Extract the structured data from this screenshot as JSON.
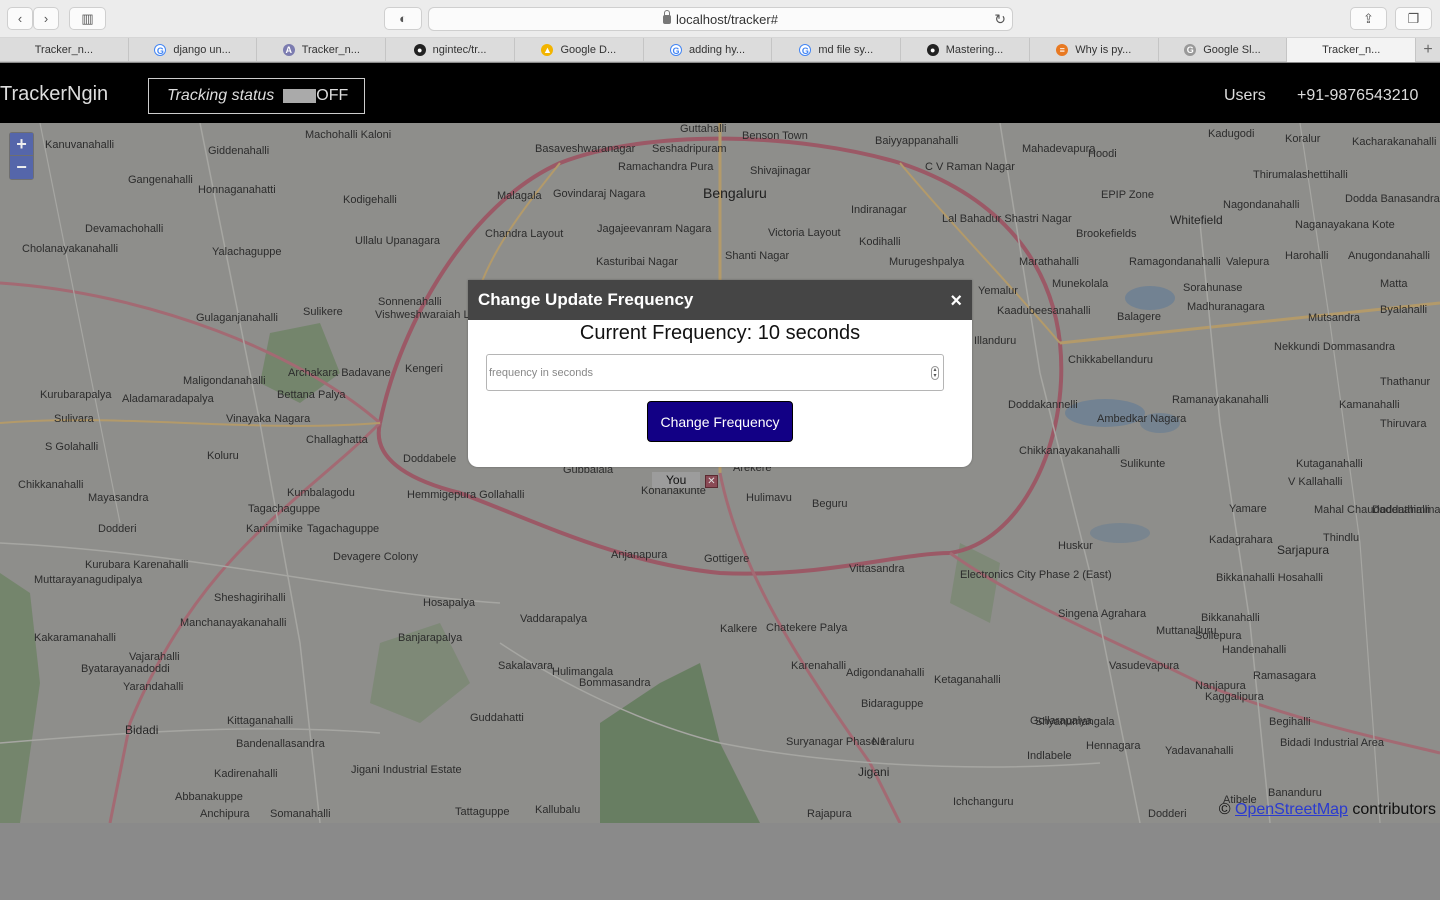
{
  "browser": {
    "url": "localhost/tracker#",
    "tabs": [
      {
        "label": "Tracker_n...",
        "icon": "none"
      },
      {
        "label": "django un...",
        "icon": "google-icon"
      },
      {
        "label": "Tracker_n...",
        "icon": "app-icon"
      },
      {
        "label": "ngintec/tr...",
        "icon": "github-icon"
      },
      {
        "label": "Google D...",
        "icon": "google-drive-icon"
      },
      {
        "label": "adding hy...",
        "icon": "google-icon"
      },
      {
        "label": "md file sy...",
        "icon": "google-icon"
      },
      {
        "label": "Mastering...",
        "icon": "github-icon"
      },
      {
        "label": "Why is py...",
        "icon": "stackoverflow-icon"
      },
      {
        "label": "Google Sl...",
        "icon": "google-slides-icon"
      },
      {
        "label": "Tracker_n...",
        "icon": "none",
        "active": true
      }
    ]
  },
  "header": {
    "brand": "TrackerNgin",
    "tracking_label": "Tracking status",
    "tracking_value": "OFF",
    "nav_users": "Users",
    "nav_phone": "+91-9876543210"
  },
  "map": {
    "you_label": "You",
    "attribution_prefix": "©",
    "attribution_link": "OpenStreetMap",
    "attribution_suffix": "contributors",
    "places": [
      {
        "t": "Bengaluru",
        "c": "big"
      },
      {
        "t": "Whitefield",
        "c": "mid"
      },
      {
        "t": "Bidadi",
        "c": "mid"
      },
      {
        "t": "Jigani",
        "c": "mid"
      },
      {
        "t": "Sarjapura",
        "c": "mid"
      },
      {
        "t": "Kanuvanahalli"
      },
      {
        "t": "Giddenahalli"
      },
      {
        "t": "Machohalli Kaloni"
      },
      {
        "t": "Basaveshwaranagar"
      },
      {
        "t": "Seshadripuram"
      },
      {
        "t": "Guttahalli"
      },
      {
        "t": "Benson Town"
      },
      {
        "t": "Baiyyappanahalli"
      },
      {
        "t": "Mahadevapura"
      },
      {
        "t": "Kadugodi"
      },
      {
        "t": "Koralur"
      },
      {
        "t": "Kacharakanahalli"
      },
      {
        "t": "Hoodi"
      },
      {
        "t": "C V Raman Nagar"
      },
      {
        "t": "Gangenahalli"
      },
      {
        "t": "Honnaganahatti"
      },
      {
        "t": "Kodigehalli"
      },
      {
        "t": "Malagala"
      },
      {
        "t": "Govindaraj Nagara"
      },
      {
        "t": "Ramachandra Pura"
      },
      {
        "t": "Shivajinagar"
      },
      {
        "t": "Thirumalashettihalli"
      },
      {
        "t": "EPIP Zone"
      },
      {
        "t": "Nagondanahalli"
      },
      {
        "t": "Dodda Banasandra"
      },
      {
        "t": "Devamachohalli"
      },
      {
        "t": "Ullalu Upanagara"
      },
      {
        "t": "Chandra Layout"
      },
      {
        "t": "Jagajeevanram Nagara"
      },
      {
        "t": "Victoria Layout"
      },
      {
        "t": "Indiranagar"
      },
      {
        "t": "Lal Bahadur Shastri Nagar"
      },
      {
        "t": "Brookefields"
      },
      {
        "t": "Naganayakana Kote"
      },
      {
        "t": "Cholanayakanahalli"
      },
      {
        "t": "Yalachaguppe"
      },
      {
        "t": "Kasturibai Nagar"
      },
      {
        "t": "Shanti Nagar"
      },
      {
        "t": "Kodihalli"
      },
      {
        "t": "Murugeshpalya"
      },
      {
        "t": "Marathahalli"
      },
      {
        "t": "Ramagondanahalli"
      },
      {
        "t": "Valepura"
      },
      {
        "t": "Harohalli"
      },
      {
        "t": "Anugondanahalli"
      },
      {
        "t": "Sonnenahalli"
      },
      {
        "t": "Vishweshwaraiah Layout"
      },
      {
        "t": "Yemalur"
      },
      {
        "t": "Munekolala"
      },
      {
        "t": "Sorahunase"
      },
      {
        "t": "Matta"
      },
      {
        "t": "Gulaganjanahalli"
      },
      {
        "t": "Sulikere"
      },
      {
        "t": "Kaadubeesanahalli"
      },
      {
        "t": "Balagere"
      },
      {
        "t": "Madhuranagara"
      },
      {
        "t": "Mutsandra"
      },
      {
        "t": "Byalahalli"
      },
      {
        "t": "Illanduru"
      },
      {
        "t": "Nekkundi Dommasandra"
      },
      {
        "t": "Maligondanahalli"
      },
      {
        "t": "Archakara Badavane"
      },
      {
        "t": "Kengeri"
      },
      {
        "t": "Chikkabellanduru"
      },
      {
        "t": "Thathanur"
      },
      {
        "t": "Kurubarapalya"
      },
      {
        "t": "Aladamaradapalya"
      },
      {
        "t": "Bettana Palya"
      },
      {
        "t": "Doddakannelli"
      },
      {
        "t": "Ramanayakanahalli"
      },
      {
        "t": "Kamanahalli"
      },
      {
        "t": "Sulivara"
      },
      {
        "t": "Vinayaka Nagara"
      },
      {
        "t": "Ambedkar Nagara"
      },
      {
        "t": "Thiruvara"
      },
      {
        "t": "S Golahalli"
      },
      {
        "t": "Challaghatta"
      },
      {
        "t": "Chikkanayakanahalli"
      },
      {
        "t": "Koluru"
      },
      {
        "t": "Doddabele"
      },
      {
        "t": "Gubbalala"
      },
      {
        "t": "Arekere"
      },
      {
        "t": "Sulikunte"
      },
      {
        "t": "Kutaganahalli"
      },
      {
        "t": "Chikkanahalli"
      },
      {
        "t": "Konanakunte"
      },
      {
        "t": "Hulimavu"
      },
      {
        "t": "V Kallahalli"
      },
      {
        "t": "Mayasandra"
      },
      {
        "t": "Kumbalagodu"
      },
      {
        "t": "Hemmigepura Gollahalli"
      },
      {
        "t": "Doddathimmasandra"
      },
      {
        "t": "Tagachaguppe"
      },
      {
        "t": "Beguru"
      },
      {
        "t": "Yamare"
      },
      {
        "t": "Mahal Chaudadenahalli"
      },
      {
        "t": "Dodderi"
      },
      {
        "t": "Kanimimike"
      },
      {
        "t": "Tagachaguppe"
      },
      {
        "t": "Kadagrahara"
      },
      {
        "t": "Huskur"
      },
      {
        "t": "Thindlu"
      },
      {
        "t": "Anjanapura"
      },
      {
        "t": "Gottigere"
      },
      {
        "t": "Devagere Colony"
      },
      {
        "t": "Kurubara Karenahalli"
      },
      {
        "t": "Vittasandra"
      },
      {
        "t": "Electronics City Phase 2 (East)"
      },
      {
        "t": "Muttarayanagudipalya"
      },
      {
        "t": "Bikkanahalli Hosahalli"
      },
      {
        "t": "Sheshagirihalli"
      },
      {
        "t": "Hosapalya"
      },
      {
        "t": "Vaddarapalya"
      },
      {
        "t": "Singena Agrahara"
      },
      {
        "t": "Bikkanahalli"
      },
      {
        "t": "Manchanayakanahalli"
      },
      {
        "t": "Chatekere Palya"
      },
      {
        "t": "Kalkere"
      },
      {
        "t": "Muttanalluru"
      },
      {
        "t": "Sollepura"
      },
      {
        "t": "Kakaramanahalli"
      },
      {
        "t": "Banjarapalya"
      },
      {
        "t": "Handenahalli"
      },
      {
        "t": "Vajarahalli"
      },
      {
        "t": "Sakalavara"
      },
      {
        "t": "Ramasagara"
      },
      {
        "t": "Karenahalli"
      },
      {
        "t": "Vasudevapura"
      },
      {
        "t": "Byatarayanadoddi"
      },
      {
        "t": "Hulimangala"
      },
      {
        "t": "Bommasandra"
      },
      {
        "t": "Adigondanahalli"
      },
      {
        "t": "Ketaganahalli"
      },
      {
        "t": "Nanjapura"
      },
      {
        "t": "Yarandahalli"
      },
      {
        "t": "Bidaraguppe"
      },
      {
        "t": "Gollarapalya"
      },
      {
        "t": "Kaggalipura"
      },
      {
        "t": "Kittaganahalli"
      },
      {
        "t": "Guddahatti"
      },
      {
        "t": "Shyanumangala"
      },
      {
        "t": "Begihalli"
      },
      {
        "t": "Bandenallasandra"
      },
      {
        "t": "Suryanagar Phase 1"
      },
      {
        "t": "Neraluru"
      },
      {
        "t": "Indlabele"
      },
      {
        "t": "Hennagara"
      },
      {
        "t": "Yadavanahalli"
      },
      {
        "t": "Bidadi Industrial Area"
      },
      {
        "t": "Kadirenahalli"
      },
      {
        "t": "Jigani Industrial Estate"
      },
      {
        "t": "Atibele"
      },
      {
        "t": "Bananduru"
      },
      {
        "t": "Abbanakuppe"
      },
      {
        "t": "Anchipura"
      },
      {
        "t": "Somanahalli"
      },
      {
        "t": "Tattaguppe"
      },
      {
        "t": "Kallubalu"
      },
      {
        "t": "Rajapura"
      },
      {
        "t": "Ichchanguru"
      },
      {
        "t": "Dodderi"
      }
    ]
  },
  "modal": {
    "title": "Change Update Frequency",
    "close": "×",
    "current_label": "Current Frequency: 10 seconds",
    "input_placeholder": "frequency in seconds",
    "submit_label": "Change Frequency"
  }
}
